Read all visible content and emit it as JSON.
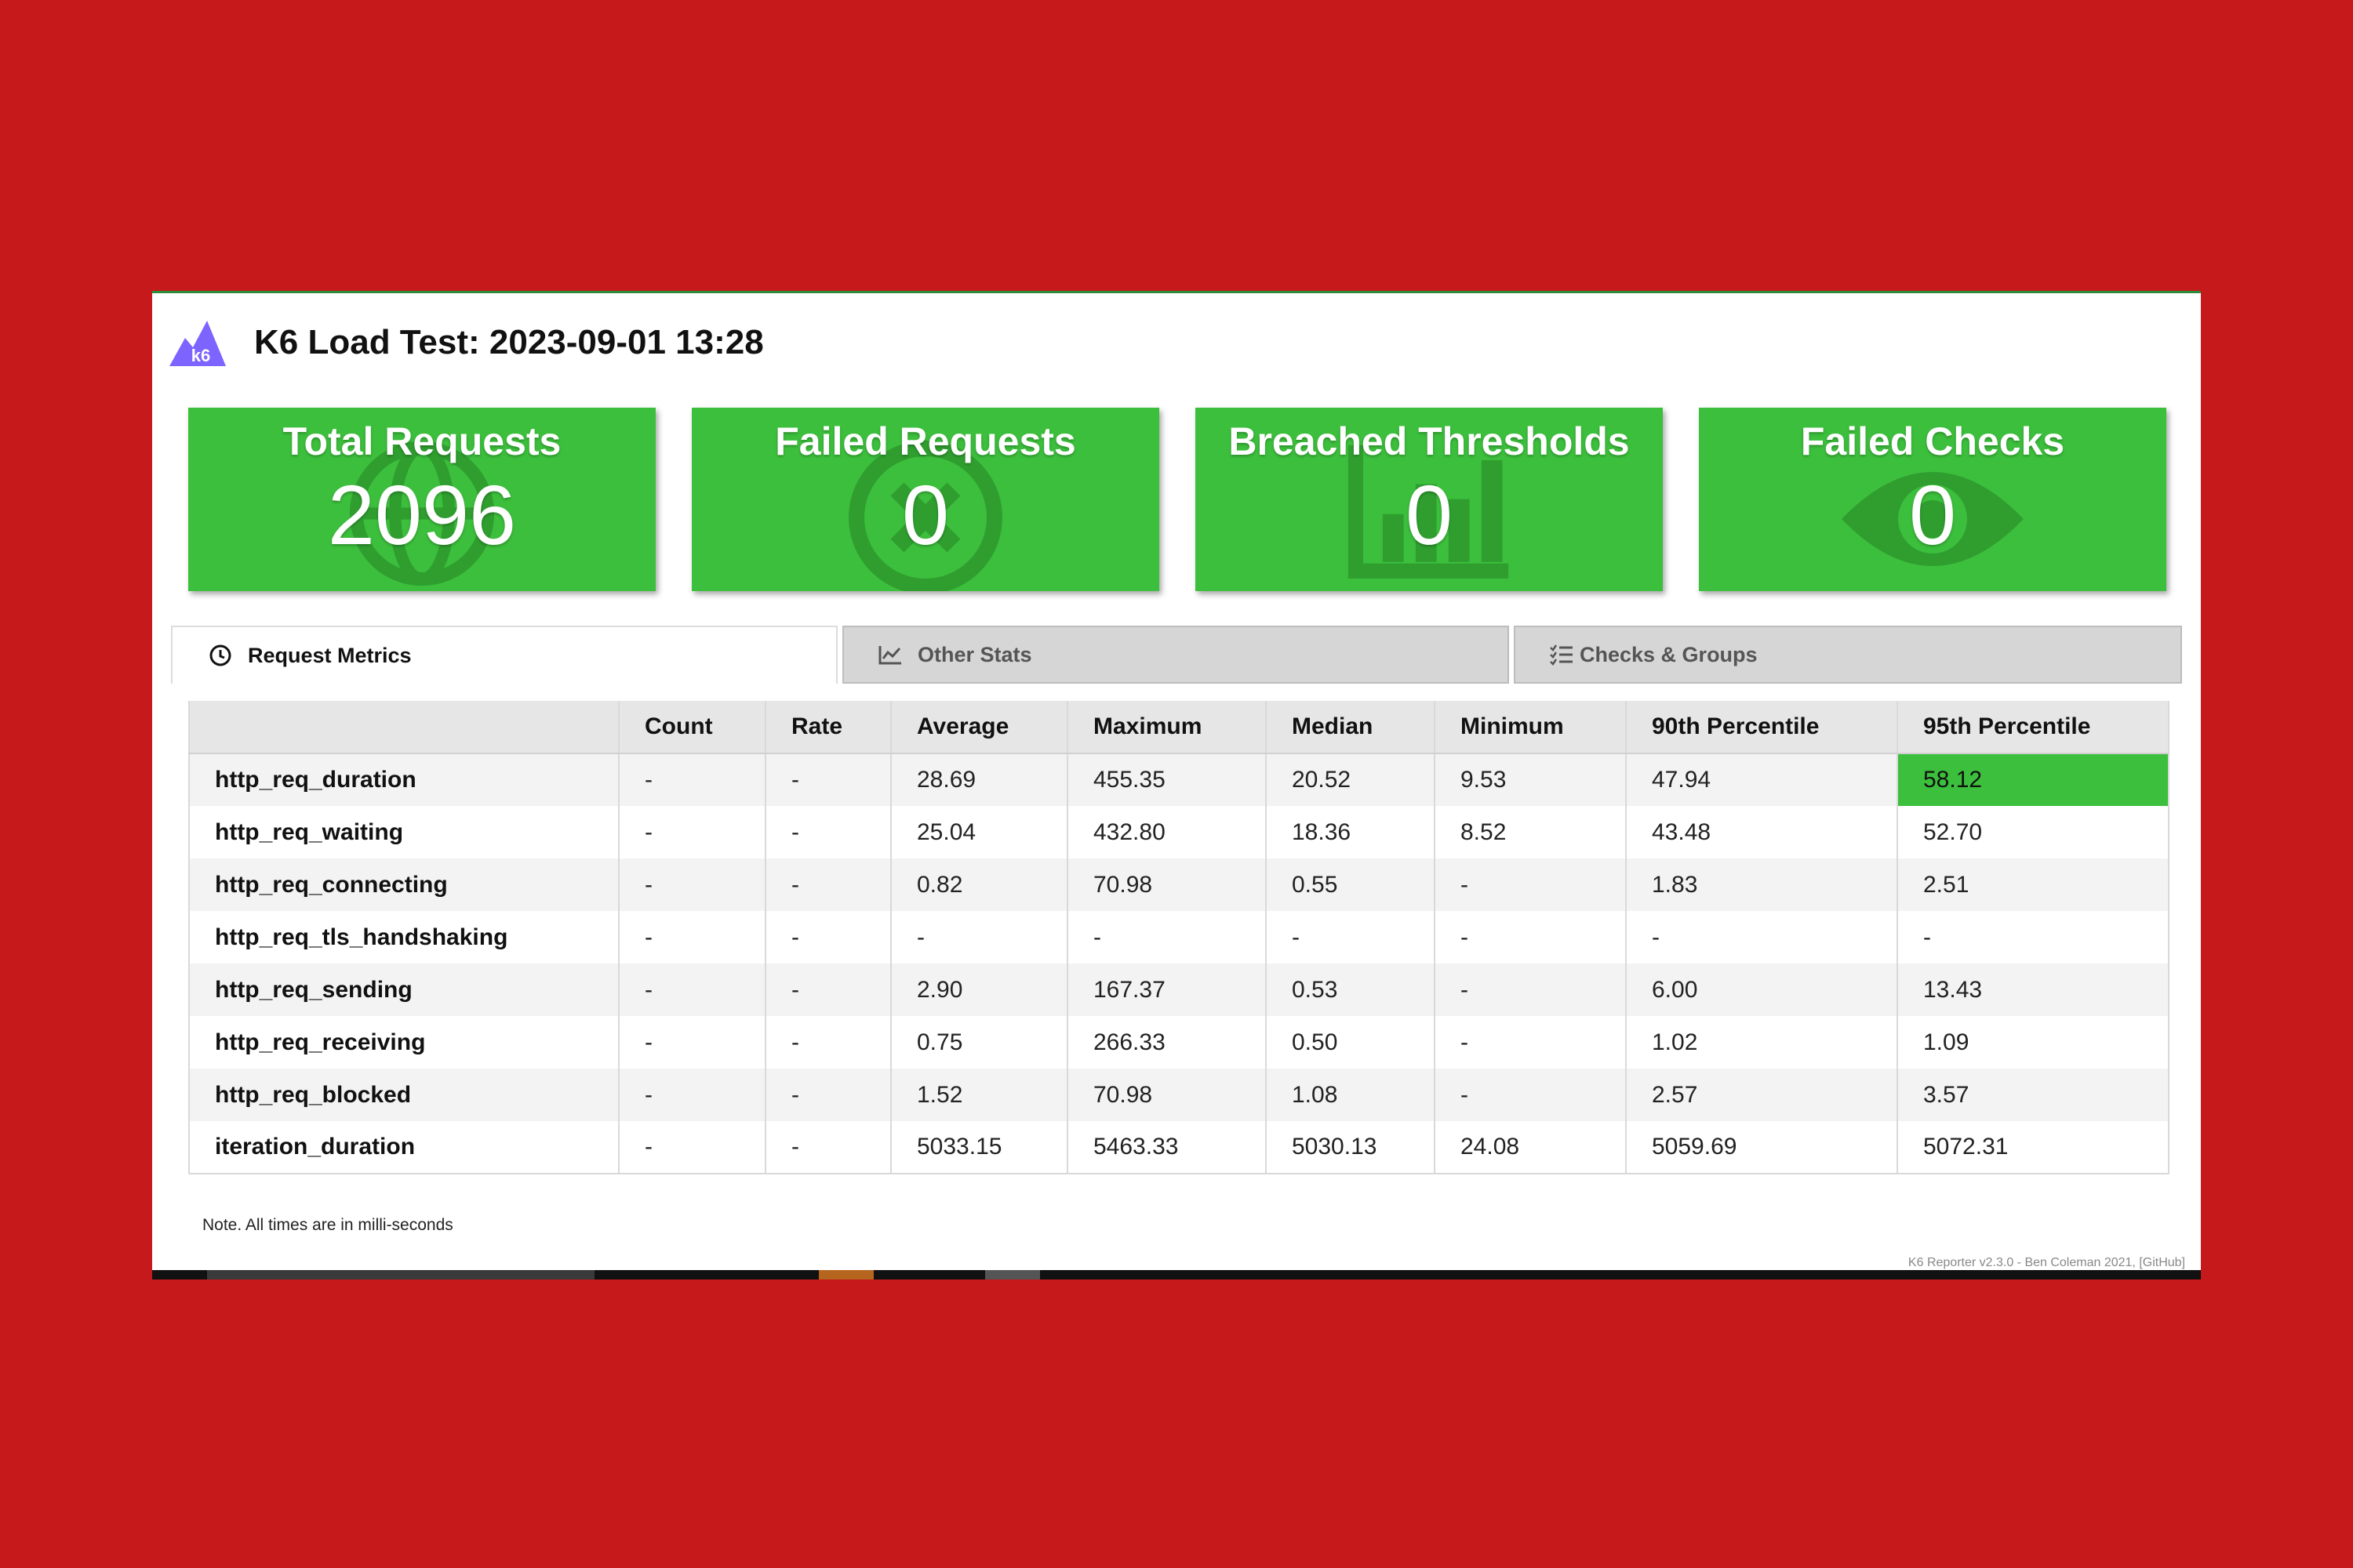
{
  "header": {
    "title": "K6 Load Test: 2023-09-01 13:28",
    "logo_icon": "k6-logo-icon",
    "logo_text": "k6"
  },
  "cards": [
    {
      "title": "Total Requests",
      "value": "2096",
      "icon": "globe-icon"
    },
    {
      "title": "Failed Requests",
      "value": "0",
      "icon": "times-circle-icon"
    },
    {
      "title": "Breached Thresholds",
      "value": "0",
      "icon": "bar-chart-icon"
    },
    {
      "title": "Failed Checks",
      "value": "0",
      "icon": "eye-icon"
    }
  ],
  "tabs": [
    {
      "label": "Request Metrics",
      "icon": "clock-icon",
      "active": true
    },
    {
      "label": "Other Stats",
      "icon": "chart-line-icon",
      "active": false
    },
    {
      "label": "Checks & Groups",
      "icon": "tasks-icon",
      "active": false
    }
  ],
  "table": {
    "headers": [
      "",
      "Count",
      "Rate",
      "Average",
      "Maximum",
      "Median",
      "Minimum",
      "90th Percentile",
      "95th Percentile"
    ],
    "rows": [
      [
        "http_req_duration",
        "-",
        "-",
        "28.69",
        "455.35",
        "20.52",
        "9.53",
        "47.94",
        "58.12"
      ],
      [
        "http_req_waiting",
        "-",
        "-",
        "25.04",
        "432.80",
        "18.36",
        "8.52",
        "43.48",
        "52.70"
      ],
      [
        "http_req_connecting",
        "-",
        "-",
        "0.82",
        "70.98",
        "0.55",
        "-",
        "1.83",
        "2.51"
      ],
      [
        "http_req_tls_handshaking",
        "-",
        "-",
        "-",
        "-",
        "-",
        "-",
        "-",
        "-"
      ],
      [
        "http_req_sending",
        "-",
        "-",
        "2.90",
        "167.37",
        "0.53",
        "-",
        "6.00",
        "13.43"
      ],
      [
        "http_req_receiving",
        "-",
        "-",
        "0.75",
        "266.33",
        "0.50",
        "-",
        "1.02",
        "1.09"
      ],
      [
        "http_req_blocked",
        "-",
        "-",
        "1.52",
        "70.98",
        "1.08",
        "-",
        "2.57",
        "3.57"
      ],
      [
        "iteration_duration",
        "-",
        "-",
        "5033.15",
        "5463.33",
        "5030.13",
        "24.08",
        "5059.69",
        "5072.31"
      ]
    ],
    "highlighted_cell": {
      "row": 0,
      "col": 8,
      "color": "#3cbf3c"
    }
  },
  "note": "Note. All times are in milli-seconds",
  "footer": "K6 Reporter v2.3.0 - Ben Coleman 2021, [GitHub]",
  "colors": {
    "background": "#c5191b",
    "card_green": "#3cbf3c",
    "card_icon": "#2f9e2f",
    "logo_purple": "#7d64ff"
  }
}
